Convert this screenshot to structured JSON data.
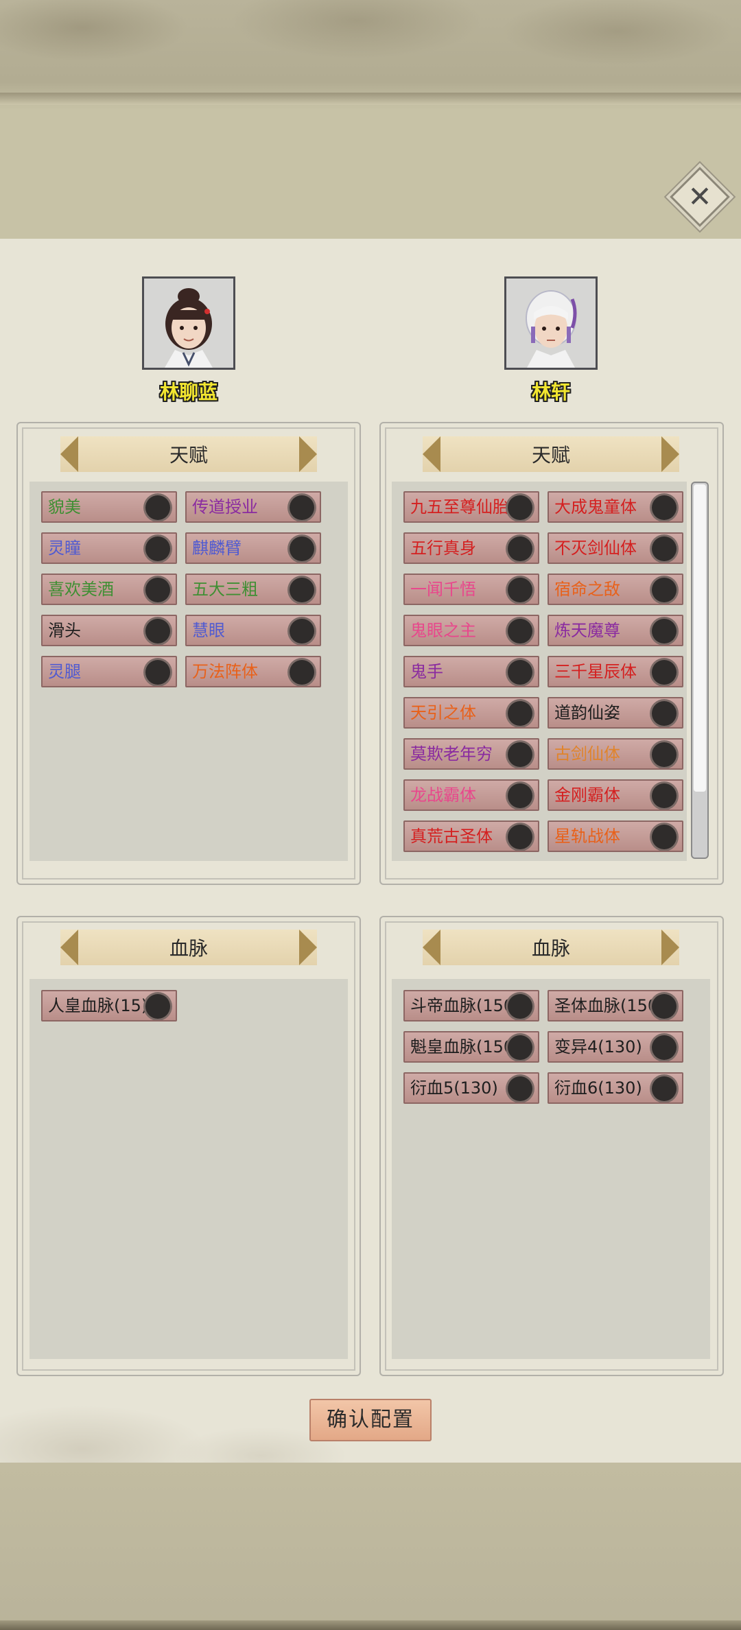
{
  "header": {
    "close_label": "✕"
  },
  "characters": [
    {
      "name": "林聊蓝"
    },
    {
      "name": "林轩"
    }
  ],
  "sections": {
    "talent_title": "天赋",
    "bloodline_title": "血脉"
  },
  "left_talents": [
    {
      "label": "貌美",
      "color": "#3f8f33"
    },
    {
      "label": "传道授业",
      "color": "#8a2ba0"
    },
    {
      "label": "灵瞳",
      "color": "#4f5ad1"
    },
    {
      "label": "麒麟臂",
      "color": "#4f5ad1"
    },
    {
      "label": "喜欢美酒",
      "color": "#3f8f33"
    },
    {
      "label": "五大三粗",
      "color": "#3f8f33"
    },
    {
      "label": "滑头",
      "color": "#1e1e1e"
    },
    {
      "label": "慧眼",
      "color": "#4f5ad1"
    },
    {
      "label": "灵腿",
      "color": "#4f5ad1"
    },
    {
      "label": "万法阵体",
      "color": "#e8611a"
    }
  ],
  "right_talents": [
    {
      "label": "九五至尊仙胎",
      "color": "#d42020"
    },
    {
      "label": "大成鬼童体",
      "color": "#d42020"
    },
    {
      "label": "五行真身",
      "color": "#d42020"
    },
    {
      "label": "不灭剑仙体",
      "color": "#d42020"
    },
    {
      "label": "一闻千悟",
      "color": "#e8478c"
    },
    {
      "label": "宿命之敌",
      "color": "#e8611a"
    },
    {
      "label": "鬼眼之主",
      "color": "#e8478c"
    },
    {
      "label": "炼天魔尊",
      "color": "#8a2ba0"
    },
    {
      "label": "鬼手",
      "color": "#8a2ba0"
    },
    {
      "label": "三千星辰体",
      "color": "#d42020"
    },
    {
      "label": "天引之体",
      "color": "#e8611a"
    },
    {
      "label": "道韵仙姿",
      "color": "#1e1e1e"
    },
    {
      "label": "莫欺老年穷",
      "color": "#8a2ba0"
    },
    {
      "label": "古剑仙体",
      "color": "#e0842c"
    },
    {
      "label": "龙战霸体",
      "color": "#e8478c"
    },
    {
      "label": "金刚霸体",
      "color": "#d42020"
    },
    {
      "label": "真荒古圣体",
      "color": "#d42020"
    },
    {
      "label": "星轨战体",
      "color": "#e8611a"
    }
  ],
  "left_bloodlines": [
    {
      "label": "人皇血脉(15)",
      "color": "#1e1e1e"
    }
  ],
  "right_bloodlines": [
    {
      "label": "斗帝血脉(150)",
      "color": "#1e1e1e"
    },
    {
      "label": "圣体血脉(150)",
      "color": "#1e1e1e"
    },
    {
      "label": "魁皇血脉(150)",
      "color": "#1e1e1e"
    },
    {
      "label": "变异4(130)",
      "color": "#1e1e1e"
    },
    {
      "label": "衍血5(130)",
      "color": "#1e1e1e"
    },
    {
      "label": "衍血6(130)",
      "color": "#1e1e1e"
    }
  ],
  "footer": {
    "confirm_label": "确认配置"
  }
}
